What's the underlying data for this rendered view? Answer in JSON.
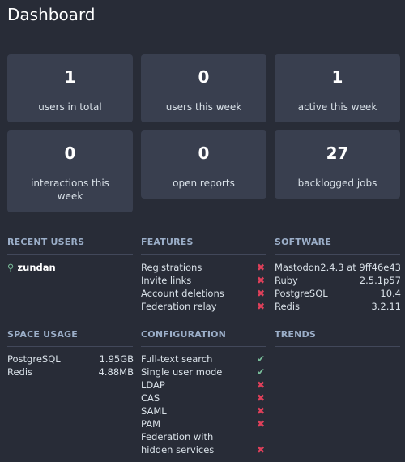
{
  "page": {
    "title": "Dashboard"
  },
  "stats": [
    {
      "value": "1",
      "label": "users in total"
    },
    {
      "value": "0",
      "label": "users this week"
    },
    {
      "value": "1",
      "label": "active this week"
    },
    {
      "value": "0",
      "label": "interactions this week"
    },
    {
      "value": "0",
      "label": "open reports"
    },
    {
      "value": "27",
      "label": "backlogged jobs"
    }
  ],
  "recent_users": {
    "heading": "RECENT USERS",
    "users": [
      "zundan"
    ]
  },
  "features": {
    "heading": "FEATURES",
    "items": [
      {
        "label": "Registrations",
        "status": "✖"
      },
      {
        "label": "Invite links",
        "status": "✖"
      },
      {
        "label": "Account deletions",
        "status": "✖"
      },
      {
        "label": "Federation relay",
        "status": "✖"
      }
    ]
  },
  "software": {
    "heading": "SOFTWARE",
    "items": [
      {
        "name": "Mastodon",
        "version": "2.4.3 at 9ff46e43"
      },
      {
        "name": "Ruby",
        "version": "2.5.1p57"
      },
      {
        "name": "PostgreSQL",
        "version": "10.4"
      },
      {
        "name": "Redis",
        "version": "3.2.11"
      }
    ]
  },
  "space_usage": {
    "heading": "SPACE USAGE",
    "items": [
      {
        "name": "PostgreSQL",
        "size": "1.95GB"
      },
      {
        "name": "Redis",
        "size": "4.88MB"
      }
    ]
  },
  "configuration": {
    "heading": "CONFIGURATION",
    "items": [
      {
        "label": "Full-text search",
        "status": "✔"
      },
      {
        "label": "Single user mode",
        "status": "✔"
      },
      {
        "label": "LDAP",
        "status": "✖"
      },
      {
        "label": "CAS",
        "status": "✖"
      },
      {
        "label": "SAML",
        "status": "✖"
      },
      {
        "label": "PAM",
        "status": "✖"
      },
      {
        "label": "Federation with hidden services",
        "status": "✖"
      }
    ]
  },
  "trends": {
    "heading": "TRENDS"
  },
  "colors": {
    "background": "#282c37",
    "card": "#393f4f",
    "enabled": "#79bd9a",
    "disabled": "#df405a",
    "heading": "#9baec8"
  }
}
